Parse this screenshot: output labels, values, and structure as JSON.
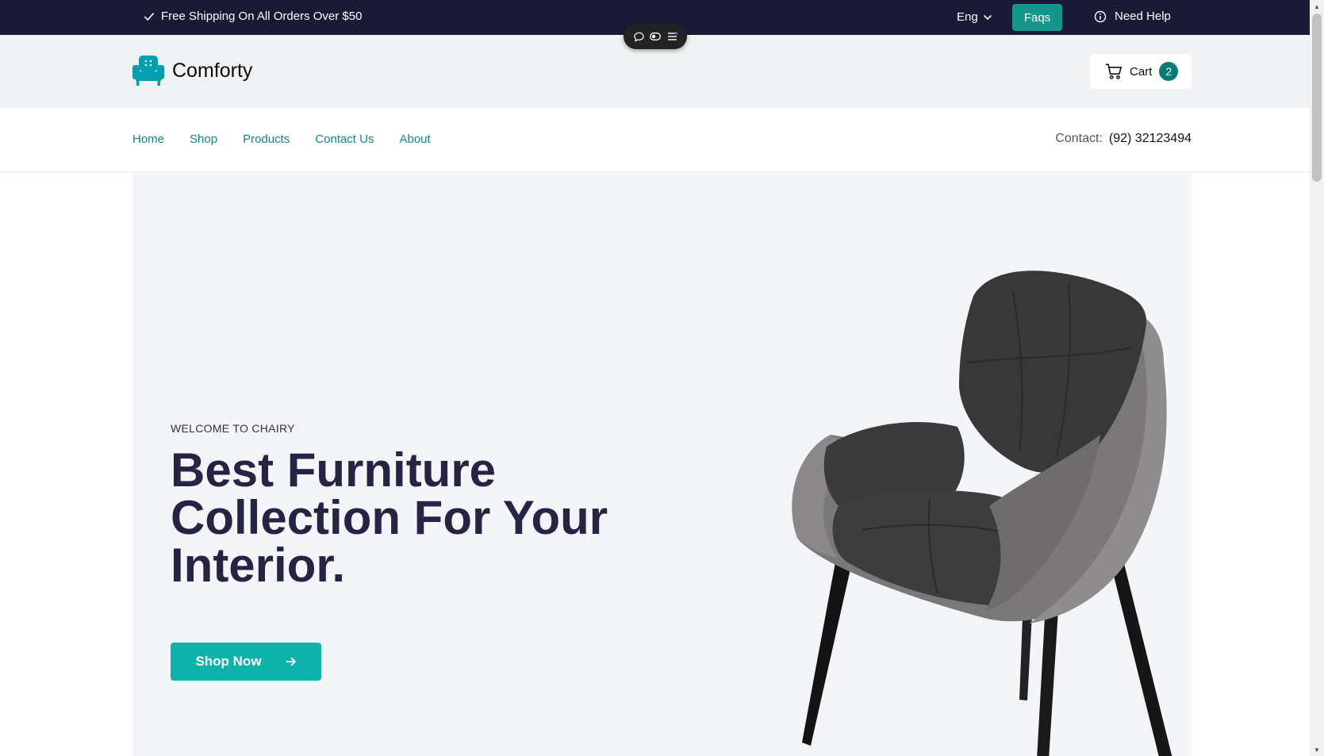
{
  "topbar": {
    "shipping_text": "Free Shipping On All Orders Over $50",
    "language": "Eng",
    "faqs_label": "Faqs",
    "help_label": "Need Help"
  },
  "header": {
    "brand_name": "Comforty",
    "cart_label": "Cart",
    "cart_count": "2"
  },
  "nav": {
    "items": [
      {
        "label": "Home"
      },
      {
        "label": "Shop"
      },
      {
        "label": "Products"
      },
      {
        "label": "Contact Us"
      },
      {
        "label": "About"
      }
    ],
    "contact_label": "Contact:",
    "contact_phone": "(92) 32123494"
  },
  "hero": {
    "eyebrow": "WELCOME TO CHAIRY",
    "title": "Best Furniture Collection For Your Interior.",
    "button_label": "Shop Now"
  },
  "colors": {
    "topbar_bg": "#1b1a36",
    "accent": "#0fb2ab",
    "faqs_bg": "#15968c",
    "nav_link": "#12877e",
    "heading": "#272343",
    "cart_badge": "#077a78"
  },
  "icons": [
    "check-icon",
    "chevron-down-icon",
    "info-icon",
    "chat-icon",
    "toggle-icon",
    "menu-icon",
    "armchair-logo-icon",
    "cart-icon",
    "arrow-right-icon"
  ]
}
